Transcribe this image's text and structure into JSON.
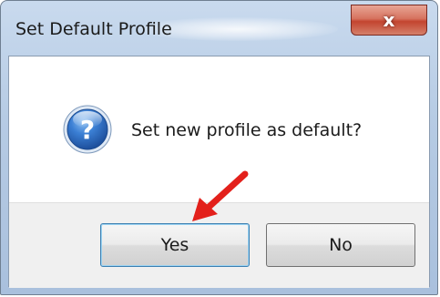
{
  "window": {
    "title": "Set Default Profile",
    "close_glyph": "x"
  },
  "dialog": {
    "icon": "question-icon",
    "message": "Set new profile as default?",
    "buttons": {
      "yes_label": "Yes",
      "no_label": "No"
    }
  },
  "annotation": {
    "arrow_color": "#e3201b",
    "points_to": "Yes"
  },
  "colors": {
    "icon_blue": "#2a64b8",
    "close_red": "#c3442f"
  }
}
